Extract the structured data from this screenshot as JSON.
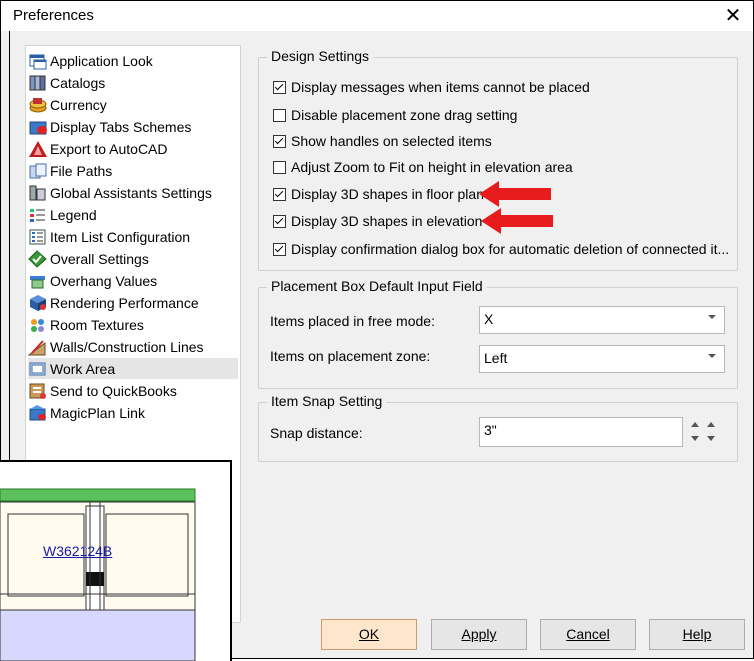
{
  "window": {
    "title": "Preferences",
    "close_glyph": "✕"
  },
  "tree": {
    "items": [
      {
        "label": "Application Look",
        "icon": "application-look-icon"
      },
      {
        "label": "Catalogs",
        "icon": "catalogs-icon"
      },
      {
        "label": "Currency",
        "icon": "currency-icon"
      },
      {
        "label": "Display Tabs Schemes",
        "icon": "display-tabs-icon"
      },
      {
        "label": "Export to AutoCAD",
        "icon": "autocad-icon"
      },
      {
        "label": "File Paths",
        "icon": "file-paths-icon"
      },
      {
        "label": "Global Assistants Settings",
        "icon": "global-assistants-icon"
      },
      {
        "label": "Legend",
        "icon": "legend-icon"
      },
      {
        "label": "Item List Configuration",
        "icon": "item-list-icon"
      },
      {
        "label": "Overall Settings",
        "icon": "overall-settings-icon"
      },
      {
        "label": "Overhang Values",
        "icon": "overhang-icon"
      },
      {
        "label": "Rendering Performance",
        "icon": "rendering-icon"
      },
      {
        "label": "Room Textures",
        "icon": "room-textures-icon"
      },
      {
        "label": "Walls/Construction Lines",
        "icon": "walls-icon"
      },
      {
        "label": "Work Area",
        "icon": "work-area-icon",
        "selected": true
      },
      {
        "label": "Send to QuickBooks",
        "icon": "quickbooks-icon"
      },
      {
        "label": "MagicPlan Link",
        "icon": "magicplan-icon"
      }
    ]
  },
  "design_settings": {
    "title": "Design Settings",
    "options": [
      {
        "label": "Display messages when items cannot be placed",
        "checked": true
      },
      {
        "label": "Disable placement zone drag setting",
        "checked": false
      },
      {
        "label": "Show handles on selected items",
        "checked": true
      },
      {
        "label": "Adjust Zoom to Fit on height in elevation area",
        "checked": false
      },
      {
        "label": "Display 3D shapes in floor plan",
        "checked": true
      },
      {
        "label": "Display 3D shapes in elevation",
        "checked": true
      },
      {
        "label": "Display confirmation dialog box for automatic deletion of connected it...",
        "checked": true
      }
    ]
  },
  "placement_box": {
    "title": "Placement Box Default Input Field",
    "free_mode_label": "Items placed in free mode:",
    "free_mode_value": "X",
    "zone_label": "Items on placement zone:",
    "zone_value": "Left"
  },
  "snap": {
    "title": "Item Snap Setting",
    "distance_label": "Snap distance:",
    "distance_value": "3\""
  },
  "buttons": {
    "ok": "OK",
    "apply": "Apply",
    "cancel": "Cancel",
    "help": "Help"
  },
  "inset": {
    "cabinet_label": "W362124B"
  },
  "colors": {
    "arrow": "#e81c1c",
    "selection": "#e5e5e5",
    "cabinet_green": "#5cc15c",
    "cabinet_lower": "#d8d8ff",
    "cabinet_upper": "#fffbef"
  }
}
